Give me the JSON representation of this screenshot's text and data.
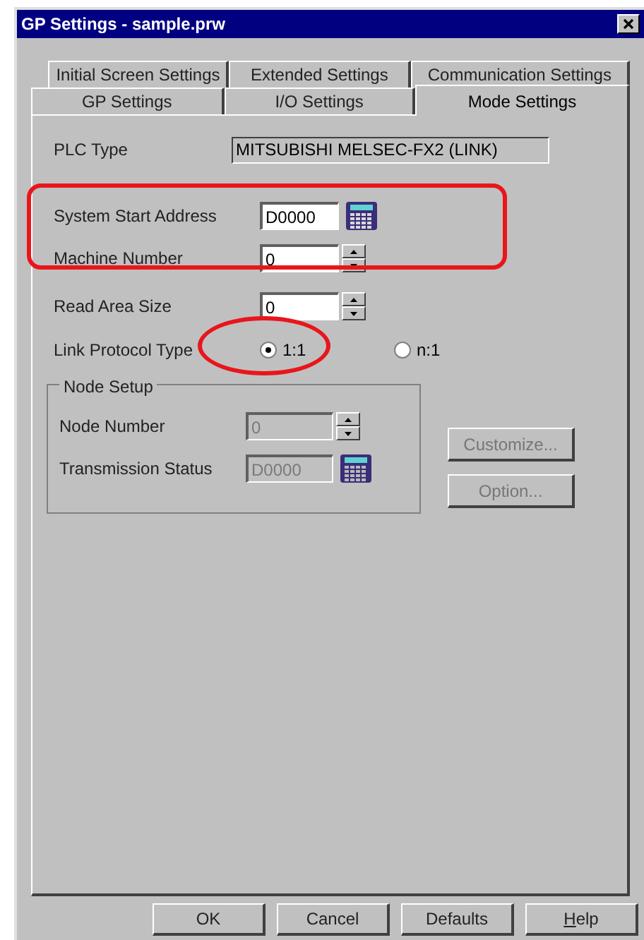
{
  "window": {
    "title": "GP Settings - sample.prw"
  },
  "tab_rows": [
    [
      {
        "label": "Initial Screen Settings",
        "selected": false
      },
      {
        "label": "Extended Settings",
        "selected": false
      },
      {
        "label": "Communication Settings",
        "selected": false
      }
    ],
    [
      {
        "label": "GP Settings",
        "selected": false
      },
      {
        "label": "I/O Settings",
        "selected": false
      },
      {
        "label": "Mode Settings",
        "selected": true
      }
    ]
  ],
  "plc_type": {
    "label": "PLC Type",
    "value": "MITSUBISHI MELSEC-FX2 (LINK)"
  },
  "fields": [
    {
      "kind": "address",
      "label": "System Start Address",
      "value": "D0000"
    },
    {
      "kind": "spin",
      "label": "Machine Number",
      "value": "0"
    },
    {
      "kind": "spin",
      "label": "Read Area Size",
      "value": "0"
    }
  ],
  "link_protocol": {
    "label": "Link Protocol Type",
    "options": [
      {
        "label": "1:1",
        "selected": true
      },
      {
        "label": "n:1",
        "selected": false
      }
    ]
  },
  "node_setup": {
    "title": "Node Setup",
    "fields": [
      {
        "kind": "spin",
        "label": "Node Number",
        "value": "0",
        "disabled": true
      },
      {
        "kind": "address",
        "label": "Transmission Status",
        "value": "D0000",
        "disabled": true
      }
    ]
  },
  "side_buttons": [
    {
      "label": "Customize...",
      "disabled": true
    },
    {
      "label": "Option...",
      "disabled": true
    }
  ],
  "buttons": [
    {
      "label": "OK",
      "mnemonic": false
    },
    {
      "label": "Cancel",
      "mnemonic": false
    },
    {
      "label": "Defaults",
      "mnemonic": false
    },
    {
      "label": "Help",
      "mnemonic": true
    }
  ],
  "annotations": [
    {
      "kind": "box"
    },
    {
      "kind": "ellipse"
    }
  ]
}
